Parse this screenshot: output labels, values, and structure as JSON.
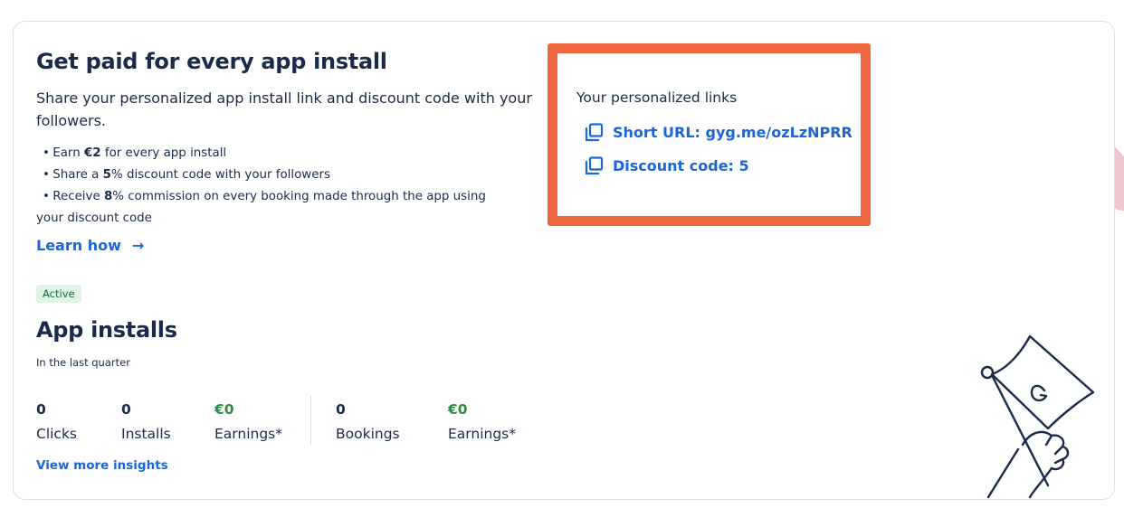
{
  "promo": {
    "title": "Get paid for every app install",
    "description": "Share your personalized app install link and discount code with your followers.",
    "bullets": [
      {
        "pre": "Earn ",
        "bold": "€2",
        "post": " for every app install",
        "cont": ""
      },
      {
        "pre": "Share a ",
        "bold": "5",
        "post": "% discount code with your followers",
        "cont": ""
      },
      {
        "pre": "Receive ",
        "bold": "8",
        "post": "% commission on every booking made through the app using",
        "cont": "your discount code"
      }
    ],
    "learn_how": "Learn how",
    "arrow": "→"
  },
  "links": {
    "title": "Your personalized links",
    "short_url": "Short URL: gyg.me/ozLzNPRR",
    "discount_code": "Discount code: 5"
  },
  "installs": {
    "badge": "Active",
    "title": "App installs",
    "subtitle": "In the last quarter",
    "metrics": [
      {
        "value": "0",
        "label": "Clicks"
      },
      {
        "value": "0",
        "label": "Installs"
      },
      {
        "value": "€0",
        "label": "Earnings*"
      },
      {
        "value": "0",
        "label": "Bookings"
      },
      {
        "value": "€0",
        "label": "Earnings*"
      }
    ],
    "view_more": "View more insights"
  },
  "colors": {
    "accent": "#1a66d6",
    "highlight_border": "#ef6641",
    "earnings_green": "#2f8a47",
    "badge_bg": "#dff4e5",
    "decor_arrow": "#efc6cd"
  }
}
